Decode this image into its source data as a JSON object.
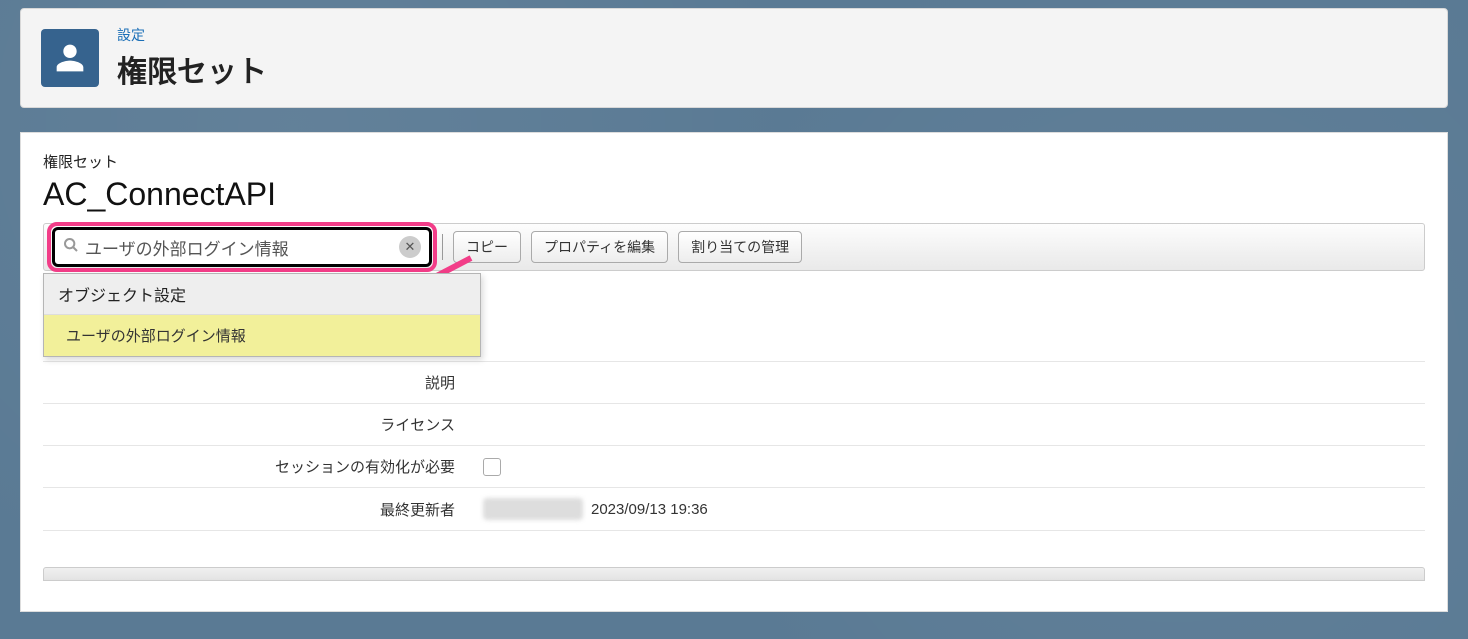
{
  "header": {
    "crumb": "設定",
    "title": "権限セット"
  },
  "pset": {
    "label": "権限セット",
    "name": "AC_ConnectAPI"
  },
  "search": {
    "value": "ユーザの外部ログイン情報"
  },
  "buttons": {
    "copy": "コピー",
    "editprops": "プロパティを編集",
    "manageassign": "割り当ての管理"
  },
  "dropdown": {
    "group": "オブジェクト設定",
    "item": "ユーザの外部ログイン情報"
  },
  "rows": {
    "description_label": "説明",
    "license_label": "ライセンス",
    "session_label": "セッションの有効化が必要",
    "lastmod_label": "最終更新者",
    "lastmod_value": "2023/09/13 19:36"
  }
}
